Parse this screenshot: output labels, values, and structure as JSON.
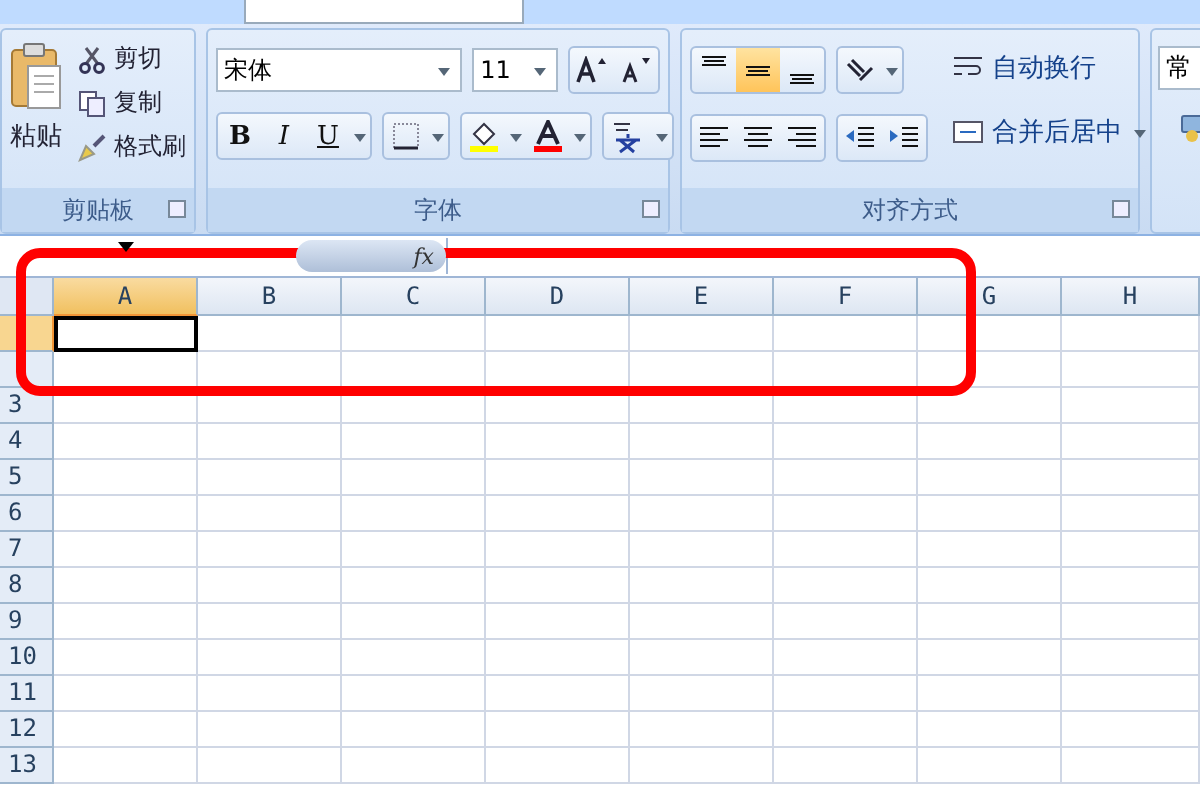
{
  "ribbon": {
    "clipboard": {
      "paste": "粘贴",
      "items": [
        {
          "kind": "cut",
          "label": "剪切"
        },
        {
          "kind": "copy",
          "label": "复制"
        },
        {
          "kind": "brush",
          "label": "格式刷"
        }
      ],
      "label": "剪贴板"
    },
    "font": {
      "name": "宋体",
      "size": "11",
      "bold": "B",
      "italic": "I",
      "underline": "U",
      "label": "字体"
    },
    "alignment": {
      "vertical": [
        {
          "kind": "top",
          "selected": false
        },
        {
          "kind": "middle",
          "selected": true
        },
        {
          "kind": "bottom",
          "selected": false
        }
      ],
      "wrap": "自动换行",
      "merge": "合并后居中",
      "label": "对齐方式"
    },
    "number": {
      "format": "常"
    }
  },
  "formula_bar": {
    "fx": "fx"
  },
  "sheet": {
    "columns": [
      {
        "label": "A",
        "selected": true
      },
      {
        "label": "B",
        "selected": false
      },
      {
        "label": "C",
        "selected": false
      },
      {
        "label": "D",
        "selected": false
      },
      {
        "label": "E",
        "selected": false
      },
      {
        "label": "F",
        "selected": false
      },
      {
        "label": "G",
        "selected": false
      },
      {
        "label": "H",
        "selected": false
      }
    ],
    "rows": [
      {
        "selected": true
      },
      {
        "selected": false
      },
      {
        "label": "3",
        "selected": false
      },
      {
        "label": "4",
        "selected": false
      },
      {
        "label": "5",
        "selected": false
      },
      {
        "label": "6",
        "selected": false
      },
      {
        "label": "7",
        "selected": false
      },
      {
        "label": "8",
        "selected": false
      },
      {
        "label": "9",
        "selected": false
      },
      {
        "label": "10",
        "selected": false
      },
      {
        "label": "11",
        "selected": false
      },
      {
        "label": "12",
        "selected": false
      },
      {
        "label": "13",
        "selected": false
      }
    ]
  }
}
